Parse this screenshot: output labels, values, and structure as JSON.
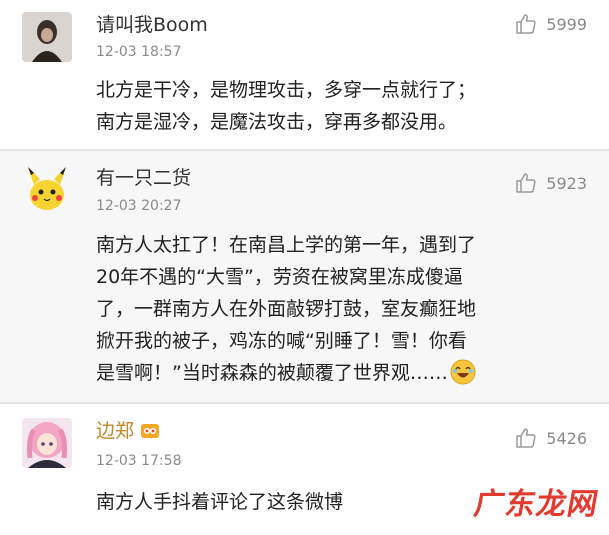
{
  "comments": [
    {
      "author": "请叫我Boom",
      "time": "12-03 18:57",
      "likes": "5999",
      "lines": [
        "北方是干冷，是物理攻击，多穿一点就行了；",
        "南方是湿冷，是魔法攻击，穿再多都没用。"
      ],
      "avatar_icon": "dark-portrait-avatar"
    },
    {
      "author": "有一只二货",
      "time": "12-03 20:27",
      "likes": "5923",
      "lines": [
        "南方人太扛了！在南昌上学的第一年，遇到了",
        "20年不遇的“大雪”，劳资在被窝里冻成傻逼",
        "了，一群南方人在外面敲锣打鼓，室友癫狂地",
        "掀开我的被子，鸡冻的喊“别睡了！雪！你看",
        "是雪啊！”当时森森的被颠覆了世界观……"
      ],
      "avatar_icon": "pikachu-avatar",
      "trailing_emoji": "laughing-emoji"
    },
    {
      "author": "边郑",
      "time": "12-03 17:58",
      "likes": "5426",
      "lines": [
        "南方人手抖着评论了这条微博"
      ],
      "avatar_icon": "anime-girl-avatar",
      "badge_icon": "vip-badge-icon"
    }
  ],
  "watermark": "广东龙网",
  "colors": {
    "like_gray": "#9a9a9a",
    "watermark_red": "#e23a2e",
    "divider": "#e6e6e6"
  }
}
